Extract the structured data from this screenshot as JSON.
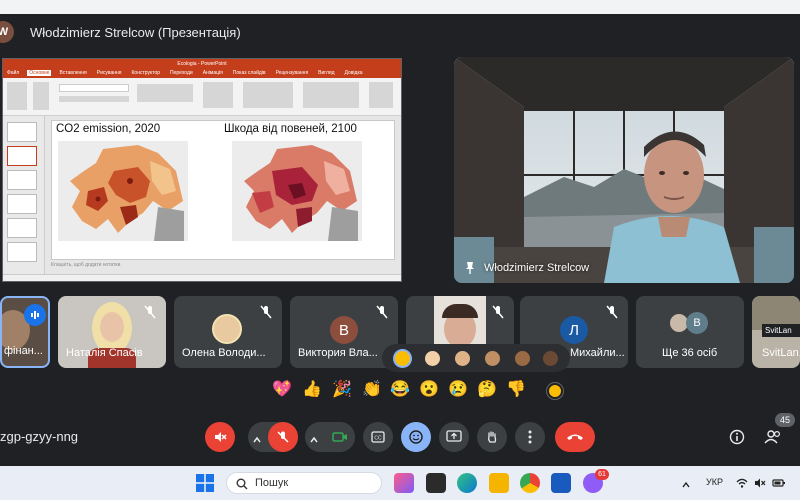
{
  "header": {
    "avatar_letter": "W",
    "presenting_title": "Włodzimierz Strelcow (Презентація)"
  },
  "presentation": {
    "app_title": "Ecologia - PowerPoint",
    "tabs": [
      "Файл",
      "Основне",
      "Вставлення",
      "Рисування",
      "Конструктор",
      "Переходи",
      "Анімація",
      "Показ слайдів",
      "Рецензування",
      "Вигляд",
      "Довідка"
    ],
    "slide_heading_left": "CO2 emission, 2020",
    "slide_heading_right": "Шкода від повеней, 2100",
    "notes_placeholder": "Клацніть, щоб додати нотатки"
  },
  "speaker": {
    "name": "Włodzimierz Strelcow"
  },
  "participants": [
    {
      "name": "фінан..."
    },
    {
      "name": "Наталія Спасів"
    },
    {
      "name": "Олена Володи..."
    },
    {
      "name": "Виктория Вла...",
      "initial": "В",
      "color": "#8d4e3e"
    },
    {
      "name": ""
    },
    {
      "name": "Михайли...",
      "initial": "Л",
      "color": "#1a5aa4"
    },
    {
      "name": "Ще 36 осіб",
      "initial": "В",
      "color": "#607d8b"
    },
    {
      "name": "SvitLan...",
      "tooltip": "SvitLan"
    }
  ],
  "tones": [
    "#fbbc04",
    "#f3d0a8",
    "#dfb388",
    "#c08f63",
    "#9a6a45",
    "#6b4a35"
  ],
  "emoji_bar": [
    "💖",
    "👍",
    "🎉",
    "👏",
    "😂",
    "😮",
    "😢",
    "🤔",
    "👎"
  ],
  "controls": {
    "meeting_code": "zgp-gzyy-nng",
    "participants_count": "45"
  },
  "taskbar": {
    "search_placeholder": "Пошук",
    "language": "УКР",
    "notification_badge": "61"
  }
}
